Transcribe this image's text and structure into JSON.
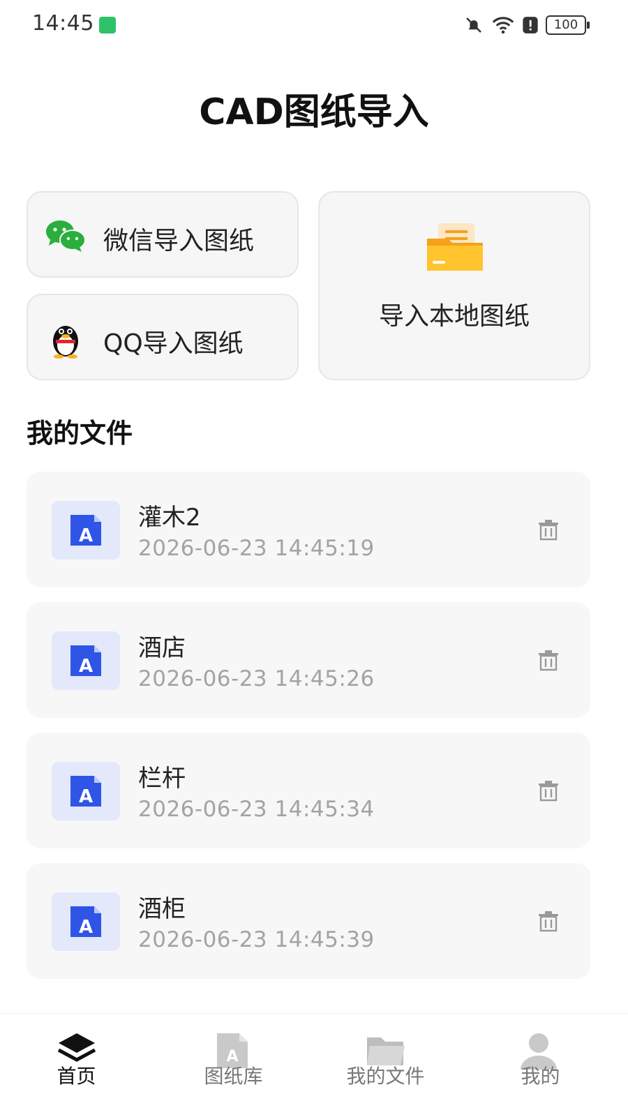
{
  "status_bar": {
    "time": "14:45",
    "battery": "100"
  },
  "title": "CAD图纸导入",
  "import": {
    "wechat_label": "微信导入图纸",
    "qq_label": "QQ导入图纸",
    "local_label": "导入本地图纸"
  },
  "section_title": "我的文件",
  "files": [
    {
      "name": "灌木2",
      "time": "2026-06-23 14:45:19"
    },
    {
      "name": "酒店",
      "time": "2026-06-23 14:45:26"
    },
    {
      "name": "栏杆",
      "time": "2026-06-23 14:45:34"
    },
    {
      "name": "酒柜",
      "time": "2026-06-23 14:45:39"
    }
  ],
  "nav": [
    {
      "label": "首页",
      "active": true
    },
    {
      "label": "图纸库"
    },
    {
      "label": "我的文件"
    },
    {
      "label": "我的"
    }
  ],
  "colors": {
    "accent_blue": "#2f55e6",
    "wechat_green": "#2aae3c",
    "folder_orange": "#f5a11a"
  }
}
